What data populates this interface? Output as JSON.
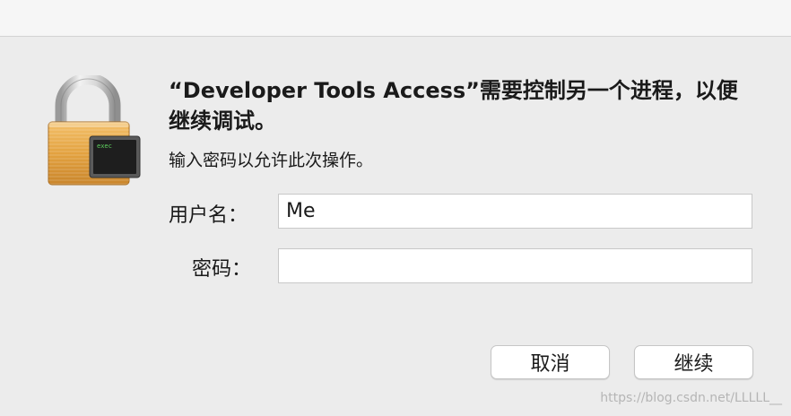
{
  "dialog": {
    "title": "“Developer Tools Access”需要控制另一个进程，以便继续调试。",
    "subtitle": "输入密码以允许此次操作。",
    "icon_name": "lock-icon",
    "terminal_badge_text": "exec"
  },
  "form": {
    "username_label": "用户名：",
    "username_value": "Me",
    "password_label": "密码：",
    "password_value": ""
  },
  "buttons": {
    "cancel_label": "取消",
    "continue_label": "继续"
  },
  "watermark": "https://blog.csdn.net/LLLLL__",
  "colors": {
    "background": "#ececec",
    "lock_body": "#e7a94a",
    "lock_shackle": "#c9c9c9",
    "terminal_bg": "#222222",
    "terminal_text": "#5fd35f"
  }
}
